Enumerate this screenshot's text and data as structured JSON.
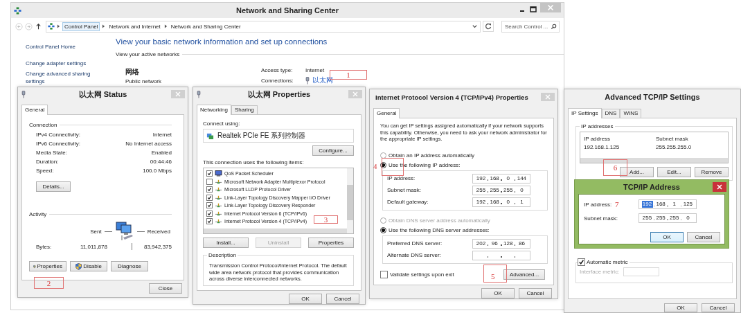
{
  "main_window": {
    "title": "Network and Sharing Center",
    "breadcrumb": [
      {
        "label": "Control Panel",
        "selected": true
      },
      {
        "label": "Network and Internet",
        "selected": false
      },
      {
        "label": "Network and Sharing Center",
        "selected": false
      }
    ],
    "search": {
      "placeholder": "Search Control ..."
    },
    "sidebar": [
      "Control Panel Home",
      "Change adapter settings",
      "Change advanced sharing settings"
    ],
    "heading": "View your basic network information and set up connections",
    "active_networks_label": "View your active networks",
    "network": {
      "name": "网络",
      "category": "Public network"
    },
    "details": [
      {
        "label": "Access type:",
        "value": "Internet",
        "kind": "text"
      },
      {
        "label": "Connections:",
        "value": "以太网",
        "kind": "link"
      }
    ]
  },
  "status_window": {
    "title": "以太网 Status",
    "tabs": [
      {
        "label": "General",
        "selected": true
      }
    ],
    "connection_heading": "Connection",
    "connection": [
      {
        "label": "IPv4 Connectivity:",
        "value": "Internet"
      },
      {
        "label": "IPv6 Connectivity:",
        "value": "No Internet access"
      },
      {
        "label": "Media State:",
        "value": "Enabled"
      },
      {
        "label": "Duration:",
        "value": "00:44:46"
      },
      {
        "label": "Speed:",
        "value": "100.0 Mbps"
      }
    ],
    "details_button": "Details...",
    "activity_heading": "Activity",
    "sent_label": "Sent",
    "received_label": "Received",
    "bytes_label": "Bytes:",
    "bytes_sent": "11,011,878",
    "bytes_received": "83,942,375",
    "buttons": [
      {
        "label": "Properties",
        "shield": true
      },
      {
        "label": "Disable",
        "shield": true
      },
      {
        "label": "Diagnose",
        "shield": false
      }
    ],
    "close_button": "Close"
  },
  "properties_window": {
    "title": "以太网 Properties",
    "tabs": [
      {
        "label": "Networking",
        "selected": true
      },
      {
        "label": "Sharing",
        "selected": false
      }
    ],
    "connect_using_label": "Connect using:",
    "adapter": "Realtek PCIe FE 系列控制器",
    "configure_button": "Configure...",
    "items_label": "This connection uses the following items:",
    "items": [
      {
        "label": "QoS Packet Scheduler",
        "checked": true,
        "kind": "scheduler"
      },
      {
        "label": "Microsoft Network Adapter Multiplexor Protocol",
        "checked": false,
        "kind": "protocol"
      },
      {
        "label": "Microsoft LLDP Protocol Driver",
        "checked": true,
        "kind": "protocol"
      },
      {
        "label": "Link-Layer Topology Discovery Mapper I/O Driver",
        "checked": true,
        "kind": "protocol"
      },
      {
        "label": "Link-Layer Topology Discovery Responder",
        "checked": true,
        "kind": "protocol"
      },
      {
        "label": "Internet Protocol Version 6 (TCP/IPv6)",
        "checked": true,
        "kind": "protocol"
      },
      {
        "label": "Internet Protocol Version 4 (TCP/IPv4)",
        "checked": true,
        "kind": "protocol"
      }
    ],
    "buttons": [
      {
        "label": "Install...",
        "disabled": false
      },
      {
        "label": "Uninstall",
        "disabled": true
      },
      {
        "label": "Properties",
        "disabled": false
      }
    ],
    "description_heading": "Description",
    "description": "Transmission Control Protocol/Internet Protocol. The default wide area network protocol that provides communication across diverse interconnected networks.",
    "ok_button": "OK",
    "cancel_button": "Cancel"
  },
  "ipv4_window": {
    "title": "Internet Protocol Version 4 (TCP/IPv4) Properties",
    "tabs": [
      {
        "label": "General",
        "selected": true
      }
    ],
    "intro": "You can get IP settings assigned automatically if your network supports this capability. Otherwise, you need to ask your network administrator for the appropriate IP settings.",
    "ip_options": [
      {
        "label": "Obtain an IP address automatically",
        "selected": false,
        "disabled": false
      },
      {
        "label": "Use the following IP address:",
        "selected": true,
        "disabled": false
      }
    ],
    "ip_fields": [
      {
        "label": "IP address:",
        "octets": [
          "192",
          "168",
          "0",
          "144"
        ]
      },
      {
        "label": "Subnet mask:",
        "octets": [
          "255",
          "255",
          "255",
          "0"
        ]
      },
      {
        "label": "Default gateway:",
        "octets": [
          "192",
          "168",
          "0",
          "1"
        ]
      }
    ],
    "dns_options": [
      {
        "label": "Obtain DNS server address automatically",
        "selected": false,
        "disabled": true
      },
      {
        "label": "Use the following DNS server addresses:",
        "selected": true,
        "disabled": false
      }
    ],
    "dns_fields": [
      {
        "label": "Preferred DNS server:",
        "octets": [
          "202",
          "96",
          "128",
          "86"
        ]
      },
      {
        "label": "Alternate DNS server:"
      }
    ],
    "validate": {
      "label": "Validate settings upon exit",
      "checked": false
    },
    "advanced_button": "Advanced...",
    "ok_button": "OK",
    "cancel_button": "Cancel"
  },
  "advanced_window": {
    "title": "Advanced TCP/IP Settings",
    "tabs": [
      {
        "label": "IP Settings",
        "selected": true
      },
      {
        "label": "DNS",
        "selected": false
      },
      {
        "label": "WINS",
        "selected": false
      }
    ],
    "ip_group": "IP addresses",
    "table": {
      "columns": [
        "IP address",
        "Subnet mask"
      ],
      "rows": [
        [
          "192.168.1.125",
          "255.255.255.0"
        ]
      ]
    },
    "buttons": [
      "Add...",
      "Edit...",
      "Remove"
    ],
    "automatic_metric": {
      "label": "Automatic metric",
      "checked": true
    },
    "interface_metric": {
      "label": "Interface metric:",
      "disabled": true
    },
    "ok_button": "OK",
    "cancel_button": "Cancel"
  },
  "address_dialog": {
    "title": "TCP/IP Address",
    "fields": [
      {
        "label": "IP address:",
        "octets": [
          {
            "text": "192",
            "selected": true
          },
          {
            "text": "168",
            "selected": false
          },
          {
            "text": "1",
            "selected": false
          },
          {
            "text": "125",
            "selected": false
          }
        ]
      },
      {
        "label": "Subnet mask:",
        "octets": [
          {
            "text": "255",
            "selected": false
          },
          {
            "text": "255",
            "selected": false
          },
          {
            "text": "255",
            "selected": false
          },
          {
            "text": "0",
            "selected": false
          }
        ]
      }
    ],
    "ok_button": "OK",
    "cancel_button": "Cancel"
  },
  "annotations": [
    {
      "label": "1",
      "kind": "boxed"
    },
    {
      "label": "2",
      "kind": "boxed"
    },
    {
      "label": "3",
      "kind": "boxed"
    },
    {
      "label": "4",
      "kind": "side"
    },
    {
      "label": "5",
      "kind": "boxed"
    },
    {
      "label": "6",
      "kind": "boxed"
    },
    {
      "label": "7",
      "kind": "plain"
    }
  ]
}
